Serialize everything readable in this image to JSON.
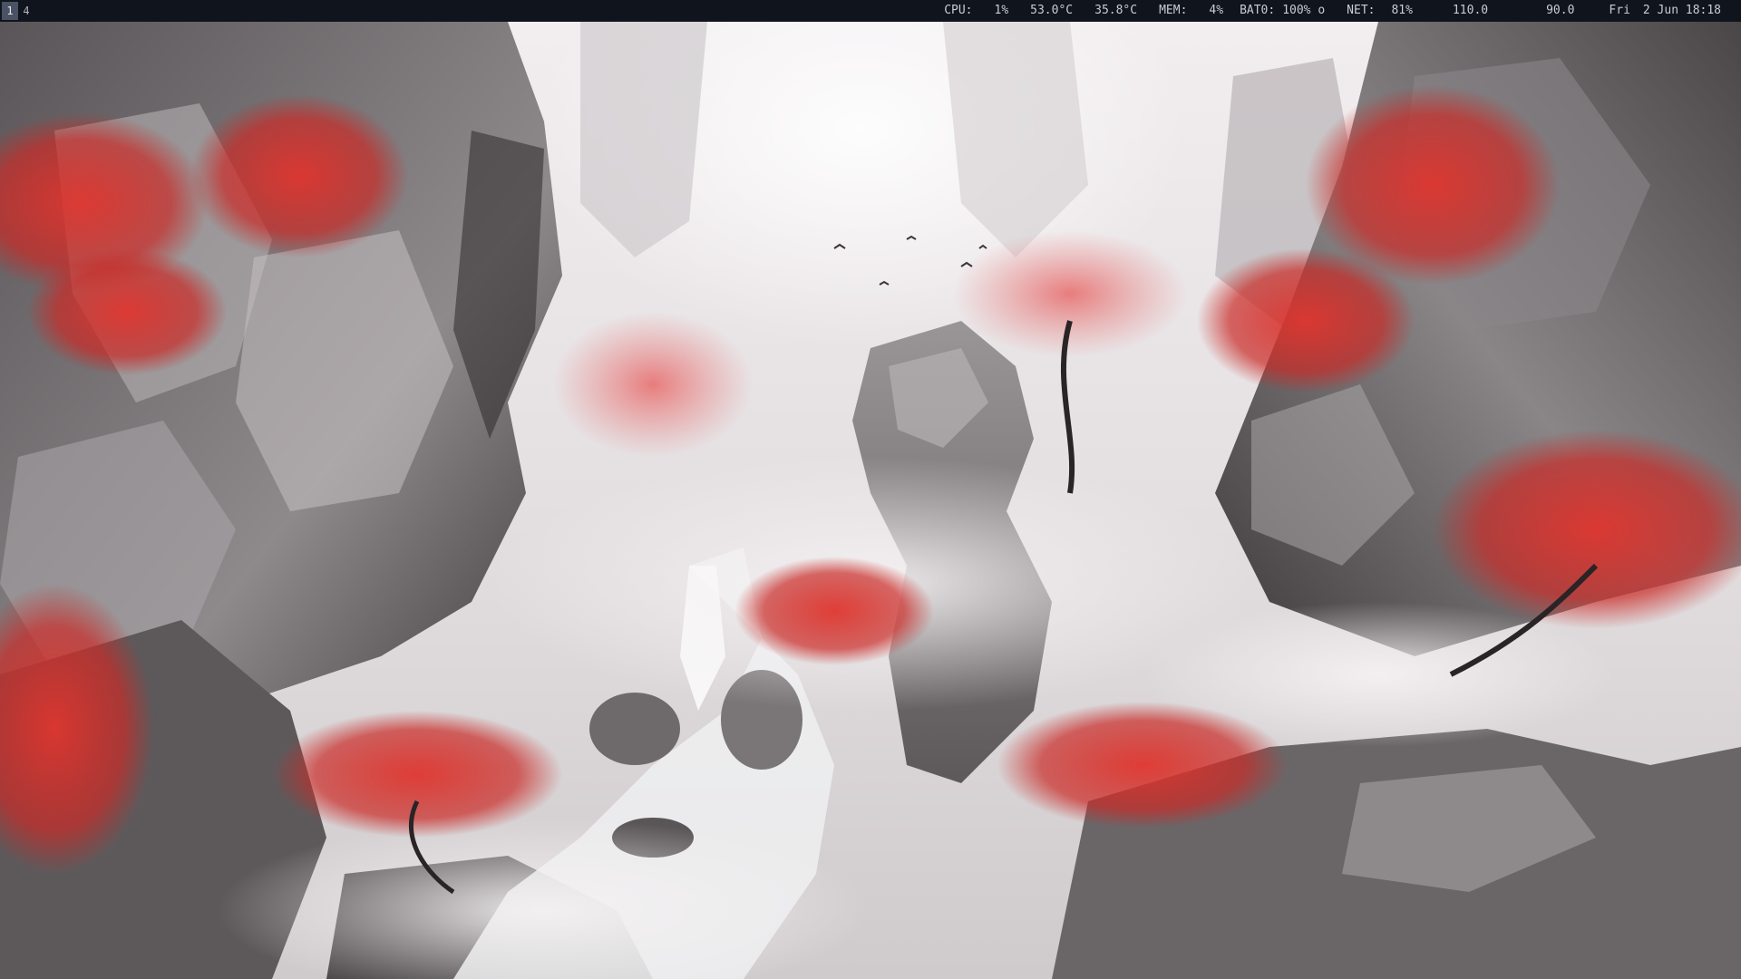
{
  "workspaces": [
    {
      "label": "1",
      "active": true
    },
    {
      "label": "4",
      "active": false
    }
  ],
  "status": {
    "cpu_label": "CPU:",
    "cpu_value": "1%",
    "temp1": "53.0°C",
    "temp2": "35.8°C",
    "mem_label": "MEM:",
    "mem_value": "4%",
    "bat_label": "BAT0:",
    "bat_value": "100% o",
    "net_label": "NET:",
    "net_value": "81%",
    "val1": "110.0",
    "val2": "90.0",
    "day": "Fri",
    "date": "2 Jun 18:18"
  },
  "colors": {
    "bar_bg": "#10141c",
    "bar_text": "#c9ccd3",
    "active_ws": "#4a5266",
    "foliage_red": "#d8322c",
    "mist": "#ece8ea",
    "rock_gray": "#6b676a"
  }
}
